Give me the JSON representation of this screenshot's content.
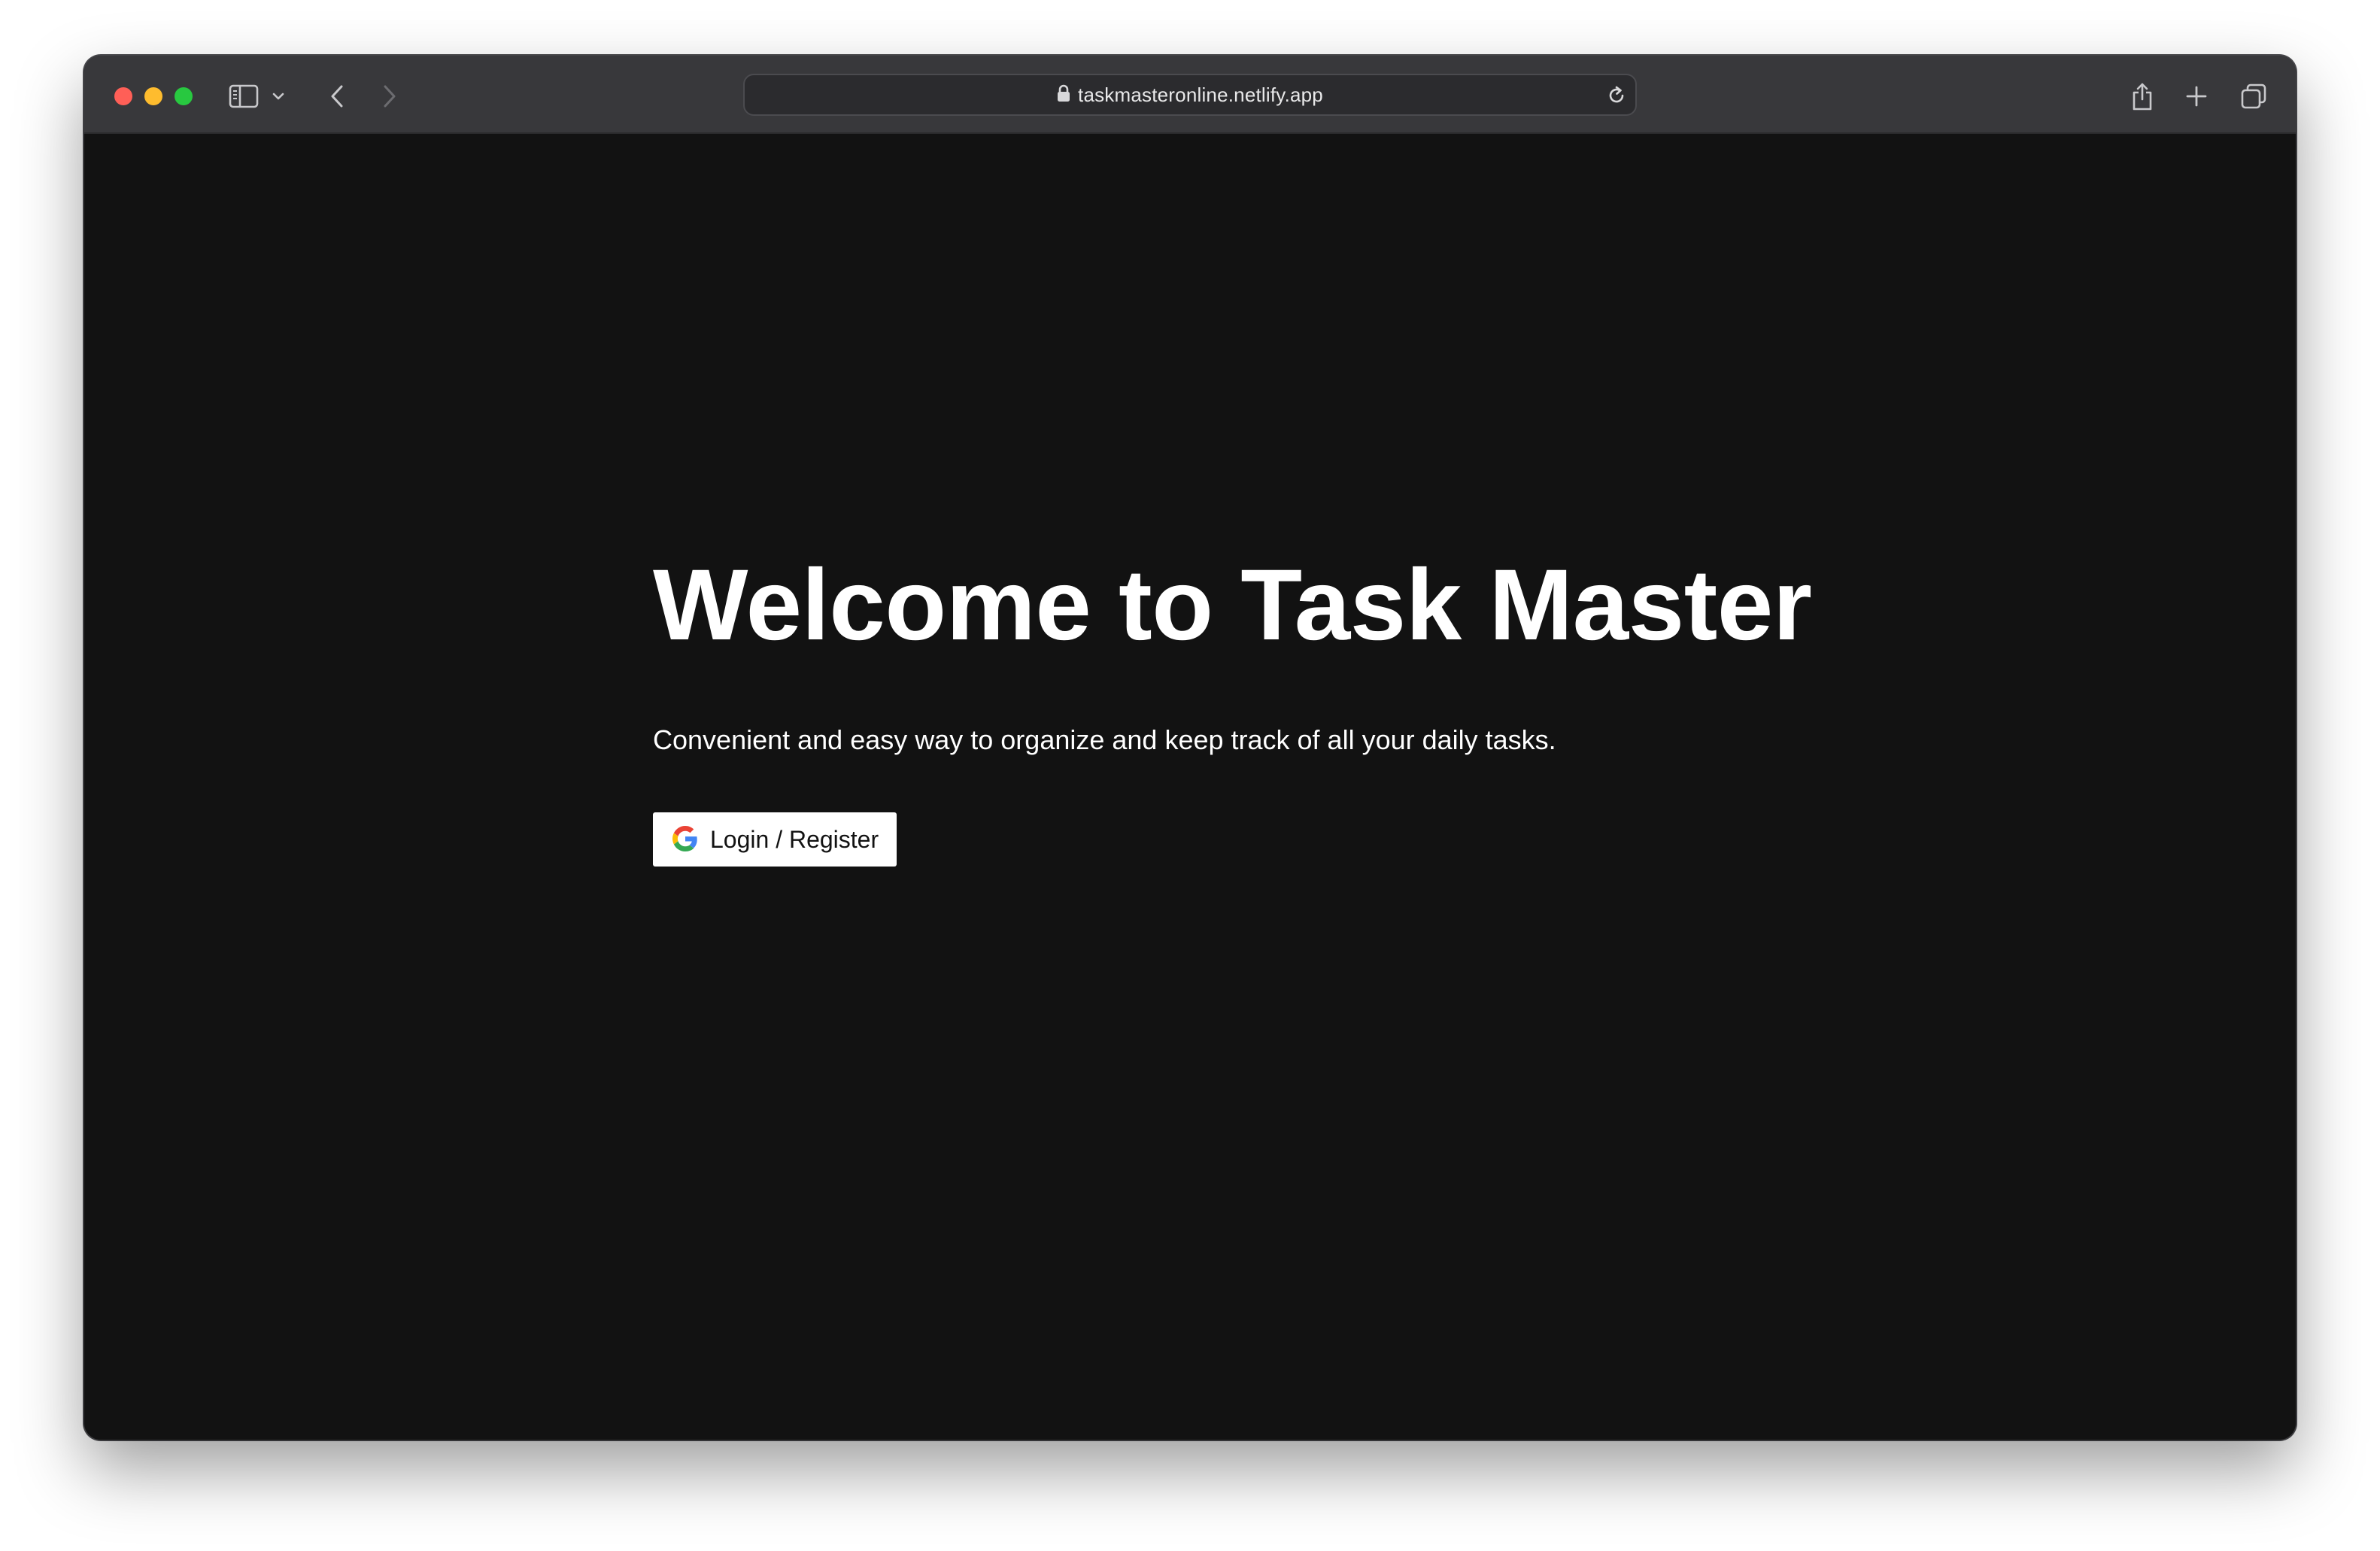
{
  "browser": {
    "url": "taskmasteronline.netlify.app",
    "icons": {
      "sidebar": "sidebar-icon",
      "sidebar_menu": "chevron-down-icon",
      "back": "back-arrow-icon",
      "forward": "forward-arrow-icon",
      "lock": "lock-icon",
      "reload": "reload-icon",
      "share": "share-icon",
      "new_tab": "plus-icon",
      "tabs": "tab-overview-icon"
    }
  },
  "page": {
    "title": "Welcome to Task Master",
    "subtitle": "Convenient and easy way to organize and keep track of all your daily tasks.",
    "login_button": {
      "label": "Login / Register",
      "icon": "google-icon"
    }
  },
  "colors": {
    "page_background": "#121212",
    "toolbar_background": "#38383b",
    "text": "#ffffff",
    "button_background": "#ffffff"
  }
}
